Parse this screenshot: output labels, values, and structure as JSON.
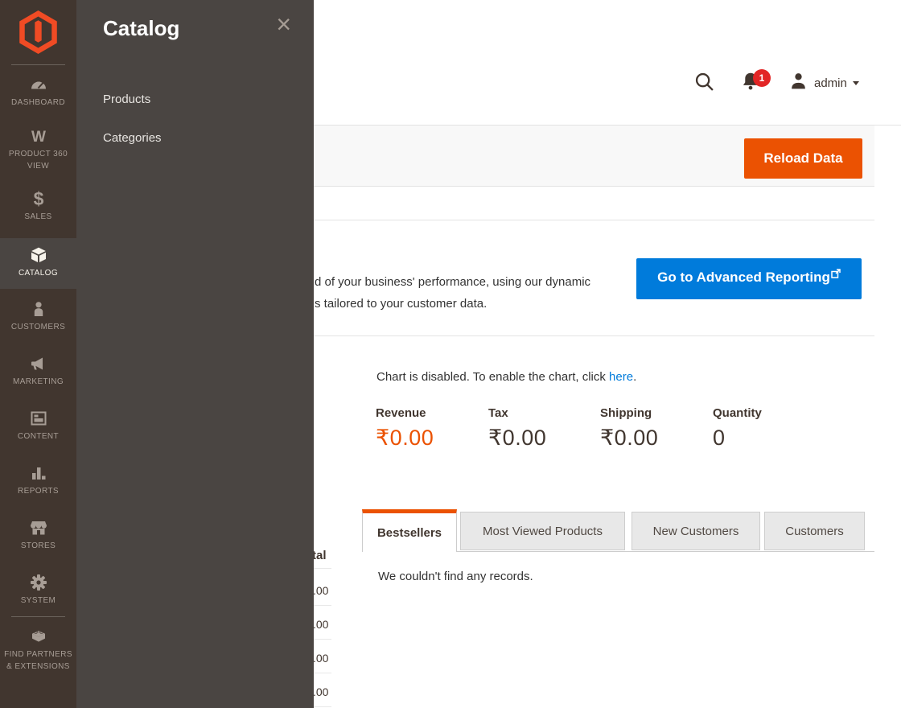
{
  "colors": {
    "accent_orange": "#eb5202",
    "accent_blue": "#007bdb",
    "badge_red": "#e22626",
    "sidebar_bg": "#41362f",
    "flyout_bg": "#4a4542",
    "logo_orange": "#f04b24"
  },
  "sidebar": {
    "items": [
      {
        "label": "DASHBOARD",
        "icon": "gauge"
      },
      {
        "label": "PRODUCT 360 VIEW",
        "icon": "w-mark"
      },
      {
        "label": "SALES",
        "icon": "dollar"
      },
      {
        "label": "CATALOG",
        "icon": "box",
        "active": true
      },
      {
        "label": "CUSTOMERS",
        "icon": "person"
      },
      {
        "label": "MARKETING",
        "icon": "megaphone"
      },
      {
        "label": "CONTENT",
        "icon": "layout"
      },
      {
        "label": "REPORTS",
        "icon": "bar-chart"
      },
      {
        "label": "STORES",
        "icon": "storefront"
      },
      {
        "label": "SYSTEM",
        "icon": "gear"
      },
      {
        "label": "FIND PARTNERS & EXTENSIONS",
        "icon": "brick"
      }
    ]
  },
  "flyout": {
    "title": "Catalog",
    "close_glyph": "×",
    "items": [
      {
        "label": "Products"
      },
      {
        "label": "Categories"
      }
    ]
  },
  "header": {
    "notification_count": "1",
    "username": "admin"
  },
  "page": {
    "reload_button": "Reload Data"
  },
  "advanced_reporting": {
    "text_line1_fragment": "d of your business' performance, using our dynamic",
    "text_line2_fragment": "s tailored to your customer data.",
    "button_label": "Go to Advanced Reporting"
  },
  "chart_notice": {
    "prefix": "Chart is disabled. To enable the chart, click ",
    "link": "here",
    "suffix": "."
  },
  "totals": [
    {
      "label": "Revenue",
      "value": "₹0.00",
      "highlight": true
    },
    {
      "label": "Tax",
      "value": "₹0.00",
      "highlight": false
    },
    {
      "label": "Shipping",
      "value": "₹0.00",
      "highlight": false
    },
    {
      "label": "Quantity",
      "value": "0",
      "highlight": false
    }
  ],
  "tabs": [
    {
      "label": "Bestsellers",
      "active": true
    },
    {
      "label": "Most Viewed Products",
      "active": false
    },
    {
      "label": "New Customers",
      "active": false
    },
    {
      "label": "Customers",
      "active": false
    }
  ],
  "tab_content": {
    "empty_message": "We couldn't find any records."
  },
  "occluded_table": {
    "header_fragment": "tal",
    "row_fragments": [
      ".00",
      ".00",
      ".00",
      ".00"
    ]
  }
}
